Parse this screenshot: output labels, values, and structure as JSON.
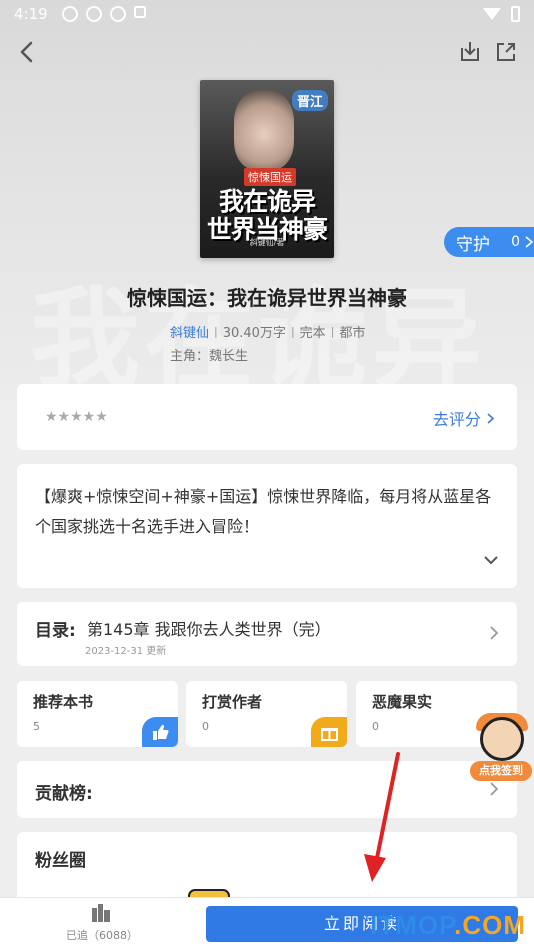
{
  "status_bar": {
    "time": "4:19"
  },
  "book": {
    "cover": {
      "publisher_badge": "晋江",
      "tag": "惊悚国运",
      "title_line1": "我在诡异",
      "title_line2": "世界当神豪",
      "author_line": "斜键仙/著"
    },
    "title": "惊悚国运：我在诡异世界当神豪",
    "author": "斜键仙",
    "word_count": "30.40万字",
    "status": "完本",
    "category": "都市",
    "protagonist": "主角：魏长生",
    "background_text": "我在诡异"
  },
  "guard": {
    "label": "守护",
    "count": "0"
  },
  "rating": {
    "stars": "★★★★★",
    "rate_link": "去评分"
  },
  "intro": {
    "text": "【爆爽+惊悚空间+神豪+国运】惊悚世界降临，每月将从蓝星各个国家挑选十名选手进入冒险！"
  },
  "toc": {
    "label": "目录:",
    "latest_chapter": "第145章 我跟你去人类世界（完）",
    "updated": "2023-12-31 更新"
  },
  "stats": [
    {
      "label": "推荐本书",
      "value": "5"
    },
    {
      "label": "打赏作者",
      "value": "0"
    },
    {
      "label": "恶魔果实",
      "value": "0"
    }
  ],
  "contrib": {
    "label": "贡献榜:"
  },
  "fans": {
    "label": "粉丝圈"
  },
  "mascot": {
    "signin_label": "点我签到"
  },
  "bottom_bar": {
    "shelf_label": "已追（6088）",
    "read_label": "立即阅读"
  },
  "watermark": {
    "text": "ITMOP",
    "domain": ".COM"
  },
  "colors": {
    "accent": "#2f7ae5",
    "link": "#3d7be0",
    "reward": "#f0aa1a"
  }
}
